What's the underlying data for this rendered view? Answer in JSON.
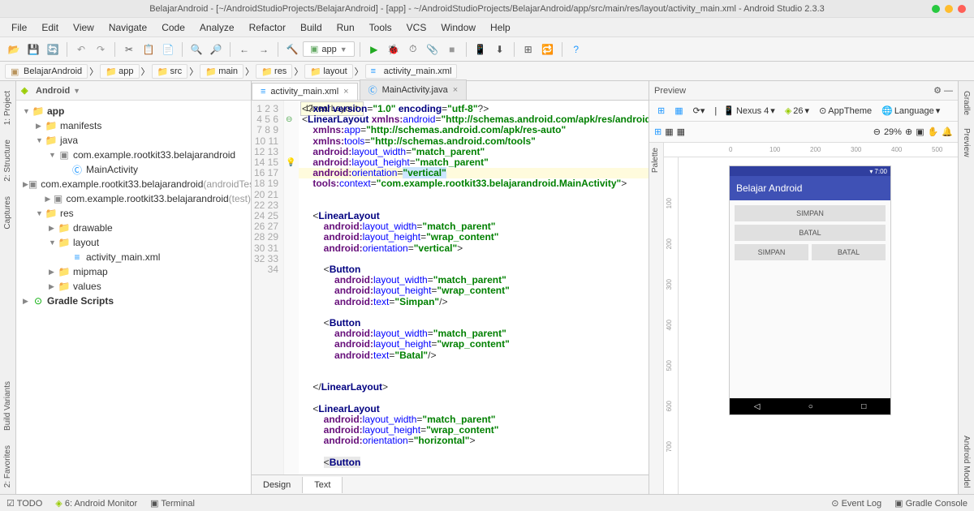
{
  "title": "BelajarAndroid - [~/AndroidStudioProjects/BelajarAndroid] - [app] - ~/AndroidStudioProjects/BelajarAndroid/app/src/main/res/layout/activity_main.xml - Android Studio 2.3.3",
  "menu": [
    "File",
    "Edit",
    "View",
    "Navigate",
    "Code",
    "Analyze",
    "Refactor",
    "Build",
    "Run",
    "Tools",
    "VCS",
    "Window",
    "Help"
  ],
  "run_config": "app",
  "breadcrumb": [
    "BelajarAndroid",
    "app",
    "src",
    "main",
    "res",
    "layout",
    "activity_main.xml"
  ],
  "project_selector": "Android",
  "tree": {
    "app": "app",
    "manifests": "manifests",
    "java": "java",
    "pkg1": "com.example.rootkit33.belajarandroid",
    "mainactivity": "MainActivity",
    "pkg2": "com.example.rootkit33.belajarandroid",
    "pkg2_suffix": "(androidTest)",
    "pkg3": "com.example.rootkit33.belajarandroid",
    "pkg3_suffix": "(test)",
    "res": "res",
    "drawable": "drawable",
    "layout": "layout",
    "activity_main": "activity_main.xml",
    "mipmap": "mipmap",
    "values": "values",
    "gradle": "Gradle Scripts"
  },
  "tabs": {
    "tab1": "activity_main.xml",
    "tab2": "MainActivity.java"
  },
  "hint": "LinearLayout",
  "code_lines": 34,
  "code": {
    "l1": "<?xml version=\"1.0\" encoding=\"utf-8\"?>",
    "l2_a": "<LinearLayout ",
    "l2_b": "xmlns:android=",
    "l2_c": "\"http://schemas.android.com/apk/res/android\"",
    "l3_a": "xmlns:app=",
    "l3_b": "\"http://schemas.android.com/apk/res-auto\"",
    "l4_a": "xmlns:tools=",
    "l4_b": "\"http://schemas.android.com/tools\"",
    "l5_a": "android:layout_width=",
    "l5_b": "\"match_parent\"",
    "l6_a": "android:layout_height=",
    "l6_b": "\"match_parent\"",
    "l7_a": "android:orientation=",
    "l7_b": "\"vertical\"",
    "l8_a": "tools:context=",
    "l8_b": "\"com.example.rootkit33.belajarandroid.MainActivity\"",
    "l8_c": ">",
    "l11": "<LinearLayout",
    "l12_a": "android:layout_width=",
    "l12_b": "\"match_parent\"",
    "l13_a": "android:layout_height=",
    "l13_b": "\"wrap_content\"",
    "l14_a": "android:orientation=",
    "l14_b": "\"vertical\"",
    "l14_c": ">",
    "l16": "<Button",
    "l17_a": "android:layout_width=",
    "l17_b": "\"match_parent\"",
    "l18_a": "android:layout_height=",
    "l18_b": "\"wrap_content\"",
    "l19_a": "android:text=",
    "l19_b": "\"Simpan\"",
    "l19_c": "/>",
    "l21": "<Button",
    "l22_a": "android:layout_width=",
    "l22_b": "\"match_parent\"",
    "l23_a": "android:layout_height=",
    "l23_b": "\"wrap_content\"",
    "l24_a": "android:text=",
    "l24_b": "\"Batal\"",
    "l24_c": "/>",
    "l27": "</LinearLayout>",
    "l29": "<LinearLayout",
    "l30_a": "android:layout_width=",
    "l30_b": "\"match_parent\"",
    "l31_a": "android:layout_height=",
    "l31_b": "\"wrap_content\"",
    "l32_a": "android:orientation=",
    "l32_b": "\"horizontal\"",
    "l32_c": ">",
    "l34": "<Button"
  },
  "bottom_tabs": {
    "design": "Design",
    "text": "Text"
  },
  "preview": {
    "title": "Preview",
    "device": "Nexus 4",
    "api": "26",
    "theme": "AppTheme",
    "lang": "Language",
    "zoom": "29%",
    "palette": "Palette",
    "app_title": "Belajar Android",
    "time": "7:00",
    "btn_simpan": "SIMPAN",
    "btn_batal": "BATAL"
  },
  "ruler_marks": [
    "0",
    "100",
    "200",
    "300",
    "400",
    "500"
  ],
  "ruler_v_marks": [
    "100",
    "200",
    "300",
    "400",
    "500",
    "600",
    "700"
  ],
  "left_tabs": [
    "1: Project",
    "2: Structure",
    "Captures",
    "Build Variants",
    "2: Favorites"
  ],
  "right_tabs": [
    "Gradle",
    "Preview",
    "Android Model"
  ],
  "status": {
    "todo": "TODO",
    "monitor": "6: Android Monitor",
    "terminal": "Terminal",
    "eventlog": "Event Log",
    "gradleconsole": "Gradle Console"
  }
}
